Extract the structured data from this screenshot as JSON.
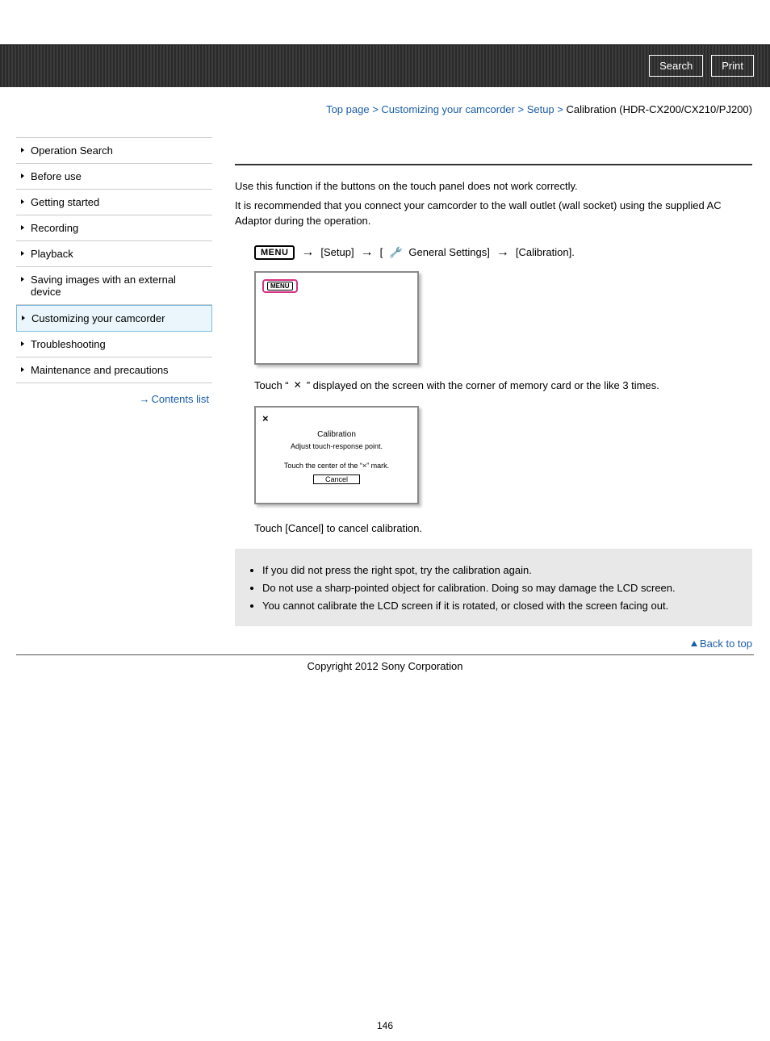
{
  "header": {
    "search": "Search",
    "print": "Print"
  },
  "sidebar": {
    "items": [
      {
        "label": "Operation Search"
      },
      {
        "label": "Before use"
      },
      {
        "label": "Getting started"
      },
      {
        "label": "Recording"
      },
      {
        "label": "Playback"
      },
      {
        "label": "Saving images with an external device"
      },
      {
        "label": "Customizing your camcorder"
      },
      {
        "label": "Troubleshooting"
      },
      {
        "label": "Maintenance and precautions"
      }
    ],
    "contents_link": "Contents list"
  },
  "breadcrumb": {
    "top": "Top page",
    "sep": " > ",
    "l1": "Customizing your camcorder",
    "l2": "Setup",
    "current": "Calibration (HDR-CX200/CX210/PJ200)"
  },
  "body": {
    "p1": "Use this function if the buttons on the touch panel does not work correctly.",
    "p2": "It is recommended that you connect your camcorder to the wall outlet (wall socket) using the supplied AC Adaptor during the operation.",
    "menu_label": "MENU",
    "step_setup": "[Setup]",
    "step_general": "General Settings]",
    "step_general_prefix": "[",
    "step_calib": "[Calibration].",
    "inner_menu": "MENU",
    "touch_pre": "Touch “",
    "touch_post": "” displayed on the screen with the corner of memory card or the like 3 times.",
    "calib_x": "×",
    "calib_t1": "Calibration",
    "calib_t2": "Adjust touch-response point.",
    "calib_t3": "Touch the center of the “×” mark.",
    "calib_cancel": "Cancel",
    "cancel_line": "Touch [Cancel] to cancel calibration.",
    "notes": [
      "If you did not press the right spot, try the calibration again.",
      "Do not use a sharp-pointed object for calibration. Doing so may damage the LCD screen.",
      "You cannot calibrate the LCD screen if it is rotated, or closed with the screen facing out."
    ],
    "back_top": "Back to top"
  },
  "footer": {
    "copyright": "Copyright 2012 Sony Corporation",
    "page_num": "146"
  }
}
